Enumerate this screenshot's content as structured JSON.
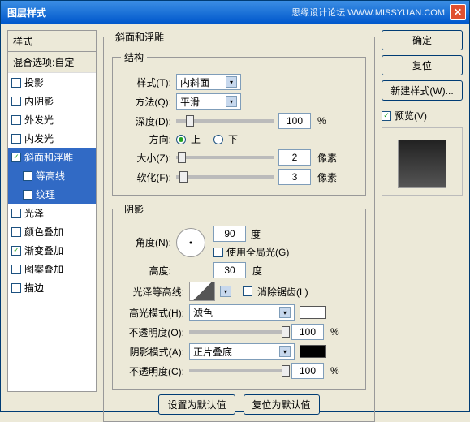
{
  "titlebar": {
    "title": "图层样式",
    "watermark": "思缘设计论坛  WWW.MISSYUAN.COM"
  },
  "sidebar": {
    "header": "样式",
    "blend": "混合选项:自定",
    "items": [
      {
        "label": "投影",
        "checked": false,
        "sel": false,
        "sub": false
      },
      {
        "label": "内阴影",
        "checked": false,
        "sel": false,
        "sub": false
      },
      {
        "label": "外发光",
        "checked": false,
        "sel": false,
        "sub": false
      },
      {
        "label": "内发光",
        "checked": false,
        "sel": false,
        "sub": false
      },
      {
        "label": "斜面和浮雕",
        "checked": true,
        "sel": true,
        "sub": false
      },
      {
        "label": "等高线",
        "checked": false,
        "sel": true,
        "sub": true
      },
      {
        "label": "纹理",
        "checked": false,
        "sel": true,
        "sub": true
      },
      {
        "label": "光泽",
        "checked": false,
        "sel": false,
        "sub": false
      },
      {
        "label": "颜色叠加",
        "checked": false,
        "sel": false,
        "sub": false
      },
      {
        "label": "渐变叠加",
        "checked": true,
        "sel": false,
        "sub": false
      },
      {
        "label": "图案叠加",
        "checked": false,
        "sel": false,
        "sub": false
      },
      {
        "label": "描边",
        "checked": false,
        "sel": false,
        "sub": false
      }
    ]
  },
  "bevel": {
    "legend": "斜面和浮雕",
    "structure_legend": "结构",
    "style_label": "样式(T):",
    "style_value": "内斜面",
    "tech_label": "方法(Q):",
    "tech_value": "平滑",
    "depth_label": "深度(D):",
    "depth_value": "100",
    "percent": "%",
    "dir_label": "方向:",
    "dir_up": "上",
    "dir_down": "下",
    "size_label": "大小(Z):",
    "size_value": "2",
    "px": "像素",
    "soften_label": "软化(F):",
    "soften_value": "3",
    "shadow_legend": "阴影",
    "angle_label": "角度(N):",
    "angle_value": "90",
    "deg": "度",
    "global_label": "使用全局光(G)",
    "alt_label": "高度:",
    "alt_value": "30",
    "gloss_label": "光泽等高线:",
    "aa_label": "消除锯齿(L)",
    "hmode_label": "高光模式(H):",
    "hmode_value": "滤色",
    "hopac_label": "不透明度(O):",
    "hopac_value": "100",
    "smode_label": "阴影模式(A):",
    "smode_value": "正片叠底",
    "sopac_label": "不透明度(C):",
    "sopac_value": "100",
    "hcolor": "#ffffff",
    "scolor": "#000000"
  },
  "buttons": {
    "make_default": "设置为默认值",
    "reset_default": "复位为默认值"
  },
  "right": {
    "ok": "确定",
    "cancel": "复位",
    "new_style": "新建样式(W)...",
    "preview": "预览(V)"
  }
}
